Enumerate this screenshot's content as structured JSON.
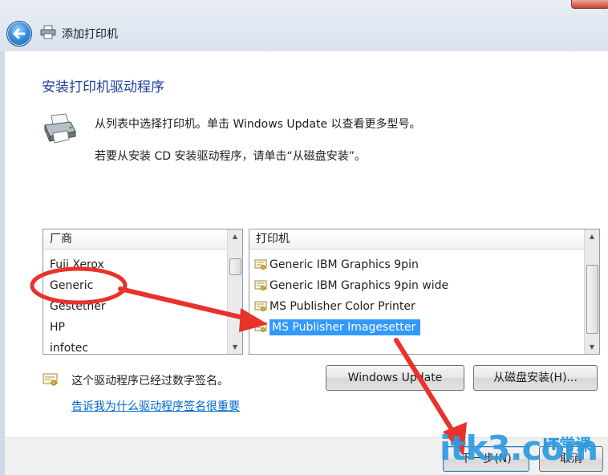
{
  "window": {
    "title": "添加打印机"
  },
  "page": {
    "heading": "安装打印机驱动程序",
    "instruction_1": "从列表中选择打印机。单击 Windows Update 以查看更多型号。",
    "instruction_2": "若要从安装 CD 安装驱动程序，请单击“从磁盘安装”。"
  },
  "manufacturer_list": {
    "header": "厂商",
    "items": [
      "Fuji Xerox",
      "Generic",
      "Gestetner",
      "HP",
      "infotec"
    ]
  },
  "printer_list": {
    "header": "打印机",
    "items": [
      "Generic IBM Graphics 9pin",
      "Generic IBM Graphics 9pin wide",
      "MS Publisher Color Printer",
      "MS Publisher Imagesetter"
    ],
    "selected": "MS Publisher Imagesetter"
  },
  "signature": {
    "status_text": "这个驱动程序已经过数字签名。",
    "link_text": "告诉我为什么驱动程序签名很重要"
  },
  "buttons": {
    "windows_update": "Windows Update",
    "have_disk": "从磁盘安装(H)...",
    "next": "下一步(N)",
    "cancel": "取消"
  },
  "watermark": {
    "text": "itk3.com",
    "sub": "IT常课"
  },
  "colors": {
    "selection": "#3399ff",
    "link": "#0066cc",
    "heading": "#1e3f9c",
    "annotation": "#e8322b",
    "watermark": "#2f9be0"
  }
}
